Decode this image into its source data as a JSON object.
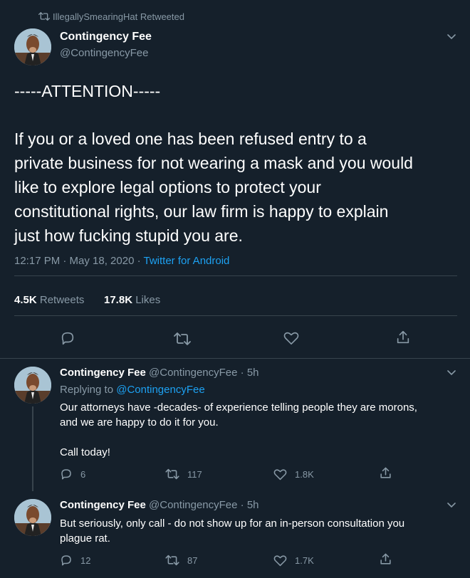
{
  "retweet_header": {
    "label": "IllegallySmearingHat Retweeted"
  },
  "main_tweet": {
    "display_name": "Contingency Fee",
    "handle": "@ContingencyFee",
    "text_line1": "-----ATTENTION-----",
    "text_lines": [
      "If you or a loved one has been refused entry to a",
      "private business for not wearing a mask and you would",
      "like to explore legal options to protect your",
      "constitutional rights, our law firm is happy to explain",
      "just how fucking stupid you are."
    ],
    "timestamp": "12:17 PM · May 18, 2020 · ",
    "client": "Twitter for Android",
    "retweets_count": "4.5K",
    "retweets_label": "Retweets",
    "likes_count": "17.8K",
    "likes_label": "Likes"
  },
  "replies": [
    {
      "display_name": "Contingency Fee",
      "handle_time": "@ContingencyFee · 5h",
      "replying_prefix": "Replying to ",
      "replying_to": "@ContingencyFee",
      "lines": [
        "Our attorneys have -decades- of experience telling people they are morons,",
        "and we are happy to do it for you.",
        "",
        "Call today!"
      ],
      "reply_count": "6",
      "retweet_count": "117",
      "like_count": "1.8K"
    },
    {
      "display_name": "Contingency Fee",
      "handle_time": "@ContingencyFee · 5h",
      "lines": [
        "But seriously, only call - do not show up for an in-person consultation you",
        "plague rat."
      ],
      "reply_count": "12",
      "retweet_count": "87",
      "like_count": "1.7K"
    }
  ],
  "colors": {
    "background": "#15202b",
    "muted": "#8899a6",
    "accent": "#1da1f2",
    "divider": "#38444d"
  }
}
